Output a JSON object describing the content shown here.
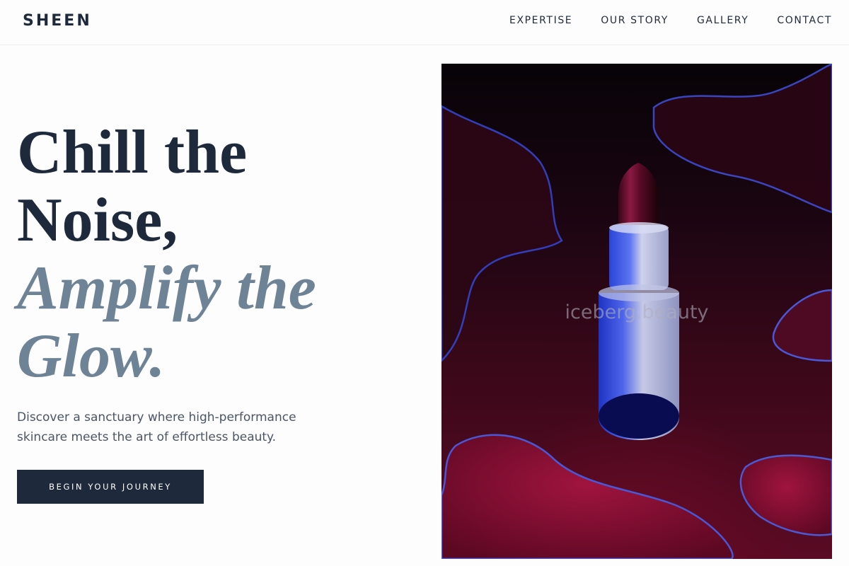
{
  "brand": {
    "logo_text": "SHEEN"
  },
  "nav": {
    "items": [
      "EXPERTISE",
      "OUR STORY",
      "GALLERY",
      "CONTACT"
    ]
  },
  "hero": {
    "headline_lines": [
      "Chill the",
      "Noise,",
      "Amplify the",
      "Glow."
    ],
    "subtext_line1": "Discover a sanctuary where high-performance",
    "subtext_line2": "skincare meets the art of effortless beauty.",
    "cta_label": "BEGIN YOUR JOURNEY",
    "image_watermark": "iceberg.beauty"
  },
  "colors": {
    "primary": "#1e2a3b",
    "accent_slate": "#6f8396",
    "background": "#fdfdfd",
    "image_crimson": "#8a0f34"
  }
}
